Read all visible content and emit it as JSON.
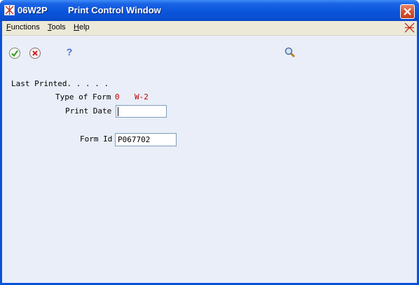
{
  "window": {
    "app_code": "06W2P",
    "title": "Print Control Window"
  },
  "menu": {
    "functions_first": "F",
    "functions_rest": "unctions",
    "tools_first": "T",
    "tools_rest": "ools",
    "help_first": "H",
    "help_rest": "elp"
  },
  "toolbar": {
    "help_glyph": "?"
  },
  "form": {
    "last_printed_label": "Last Printed. . . . .",
    "type_of_form_label": "Type of Form",
    "type_of_form_code": "0",
    "type_of_form_desc": "W-2",
    "print_date_label": "Print Date",
    "print_date_value": "",
    "form_id_label": "Form Id",
    "form_id_value": "P067702"
  },
  "colors": {
    "titlebar": "#0a55dc",
    "content_bg": "#e9eef8",
    "value_red": "#c00000"
  }
}
